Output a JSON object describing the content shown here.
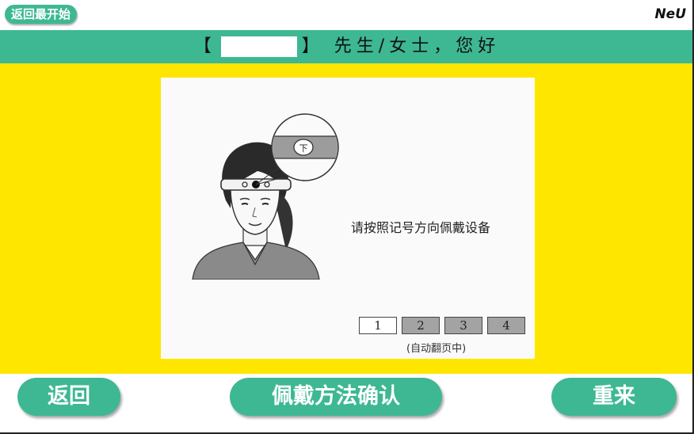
{
  "topbar": {
    "back_home_label": "返回最开始",
    "logo": "NeU"
  },
  "greeting": {
    "open_bracket": "【",
    "close_bracket": "】",
    "suffix": "先生/女士，您好"
  },
  "card": {
    "instruction": "请按照记号方向佩戴设备",
    "magnifier_glyph": "下",
    "pages": [
      "1",
      "2",
      "3",
      "4"
    ],
    "current_page": 1,
    "auto_flip": "(自动翻页中)"
  },
  "footer": {
    "back_label": "返回",
    "confirm_label": "佩戴方法确认",
    "retry_label": "重来"
  },
  "colors": {
    "accent": "#3db892",
    "background": "#ffe600"
  }
}
